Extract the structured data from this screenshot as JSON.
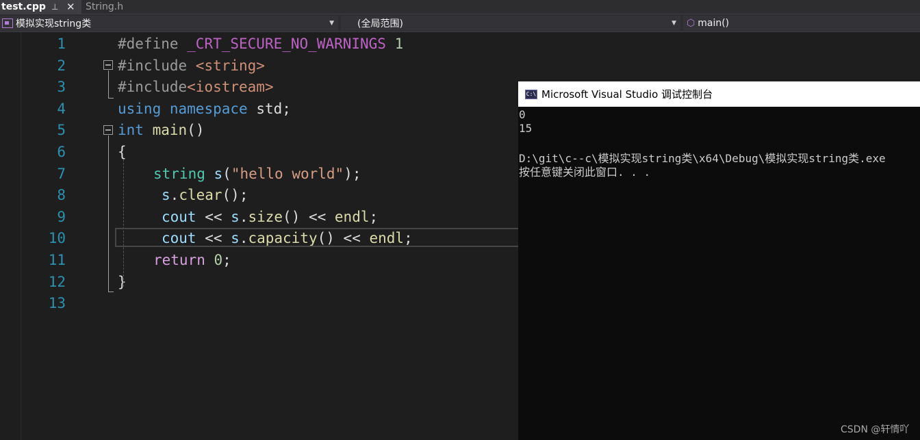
{
  "tabs": [
    {
      "label": "test.cpp",
      "active": true,
      "pin": "⊥",
      "close": "✕"
    },
    {
      "label": "String.h",
      "active": false
    }
  ],
  "navbar": {
    "project": "模拟实现string类",
    "scope": "(全局范围)",
    "member": "main()"
  },
  "editor": {
    "line_numbers": [
      "1",
      "2",
      "3",
      "4",
      "5",
      "6",
      "7",
      "8",
      "9",
      "10",
      "11",
      "12",
      "13"
    ],
    "lines": [
      [
        {
          "t": "#define ",
          "c": "pp"
        },
        {
          "t": "_CRT_SECURE_NO_WARNINGS",
          "c": "macro"
        },
        {
          "t": " 1",
          "c": "num"
        }
      ],
      [
        {
          "t": "#include ",
          "c": "pp"
        },
        {
          "t": "<string>",
          "c": "inc"
        }
      ],
      [
        {
          "t": "#include",
          "c": "pp"
        },
        {
          "t": "<iostream>",
          "c": "inc"
        }
      ],
      [
        {
          "t": "using",
          "c": "kw"
        },
        {
          "t": " ",
          "c": "plain"
        },
        {
          "t": "namespace",
          "c": "kw"
        },
        {
          "t": " std;",
          "c": "plain"
        }
      ],
      [
        {
          "t": "int",
          "c": "kw"
        },
        {
          "t": " ",
          "c": "plain"
        },
        {
          "t": "main",
          "c": "fn"
        },
        {
          "t": "()",
          "c": "plain"
        }
      ],
      [
        {
          "t": "{",
          "c": "plain"
        }
      ],
      [
        {
          "t": "string",
          "c": "ty"
        },
        {
          "t": " ",
          "c": "plain"
        },
        {
          "t": "s",
          "c": "var"
        },
        {
          "t": "(",
          "c": "plain"
        },
        {
          "t": "\"hello world\"",
          "c": "str"
        },
        {
          "t": ");",
          "c": "plain"
        }
      ],
      [
        {
          "t": "s",
          "c": "var"
        },
        {
          "t": ".",
          "c": "plain"
        },
        {
          "t": "clear",
          "c": "fn"
        },
        {
          "t": "();",
          "c": "plain"
        }
      ],
      [
        {
          "t": "cout",
          "c": "var"
        },
        {
          "t": " << ",
          "c": "plain"
        },
        {
          "t": "s",
          "c": "var"
        },
        {
          "t": ".",
          "c": "plain"
        },
        {
          "t": "size",
          "c": "fn"
        },
        {
          "t": "() << ",
          "c": "plain"
        },
        {
          "t": "endl",
          "c": "fn"
        },
        {
          "t": ";",
          "c": "plain"
        }
      ],
      [
        {
          "t": "cout",
          "c": "var"
        },
        {
          "t": " << ",
          "c": "plain"
        },
        {
          "t": "s",
          "c": "var"
        },
        {
          "t": ".",
          "c": "plain"
        },
        {
          "t": "capacity",
          "c": "fn"
        },
        {
          "t": "() << ",
          "c": "plain"
        },
        {
          "t": "endl",
          "c": "fn"
        },
        {
          "t": ";",
          "c": "plain"
        }
      ],
      [
        {
          "t": "return",
          "c": "ctl"
        },
        {
          "t": " ",
          "c": "plain"
        },
        {
          "t": "0",
          "c": "num"
        },
        {
          "t": ";",
          "c": "plain"
        }
      ],
      [
        {
          "t": "}",
          "c": "plain"
        }
      ],
      []
    ]
  },
  "console": {
    "title": "Microsoft Visual Studio 调试控制台",
    "icon_text": "C:\\",
    "lines": [
      "0",
      "15",
      "",
      "D:\\git\\c--c\\模拟实现string类\\x64\\Debug\\模拟实现string类.exe",
      "按任意键关闭此窗口. . ."
    ]
  },
  "watermark": "CSDN @轩情吖",
  "colors": {
    "background": "#1e1e1e",
    "line_number": "#2b91af",
    "keyword": "#569cd6",
    "string": "#d69d85",
    "function": "#dcdcaa",
    "console_bg": "#0c0c0c"
  }
}
